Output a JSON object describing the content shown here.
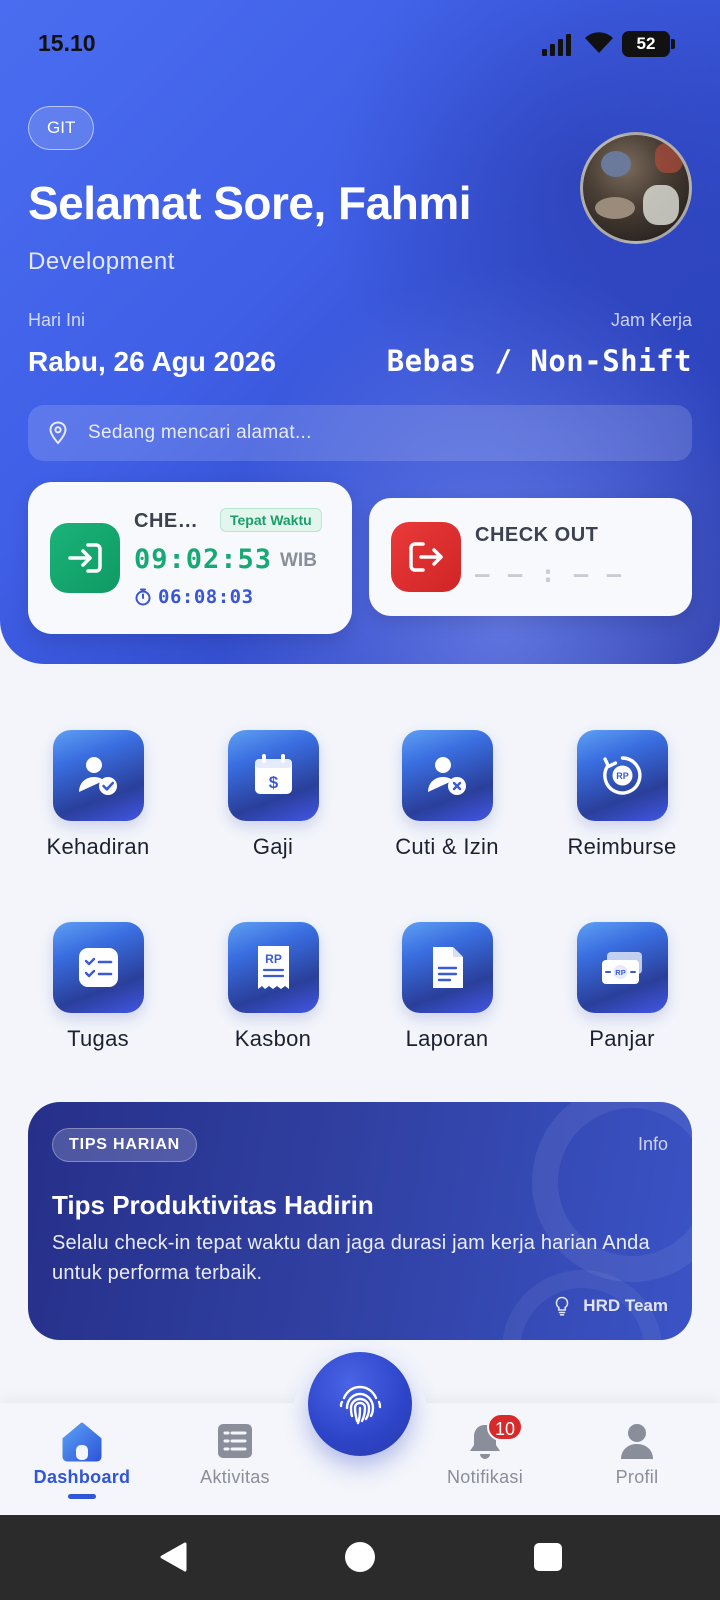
{
  "status_bar": {
    "time": "15.10",
    "battery": "52"
  },
  "header": {
    "company": "GIT",
    "greeting": "Selamat Sore, Fahmi",
    "department": "Development",
    "today_label": "Hari Ini",
    "today_value": "Rabu, 26 Agu 2026",
    "work_hours_label": "Jam Kerja",
    "work_hours_value": "Bebas / Non-Shift",
    "location_text": "Sedang mencari alamat..."
  },
  "check_in": {
    "title": "CHECK IN",
    "badge": "Tepat Waktu",
    "time": "09:02:53",
    "timezone": "WIB",
    "duration": "06:08:03"
  },
  "check_out": {
    "title": "CHECK OUT",
    "time": "— — : — —"
  },
  "menu": [
    {
      "label": "Kehadiran",
      "icon": "user-check-icon"
    },
    {
      "label": "Gaji",
      "icon": "salary-calendar-icon"
    },
    {
      "label": "Cuti & Izin",
      "icon": "user-leave-icon"
    },
    {
      "label": "Reimburse",
      "icon": "reimburse-icon"
    },
    {
      "label": "Tugas",
      "icon": "task-list-icon"
    },
    {
      "label": "Kasbon",
      "icon": "receipt-icon"
    },
    {
      "label": "Laporan",
      "icon": "document-icon"
    },
    {
      "label": "Panjar",
      "icon": "cash-icon"
    }
  ],
  "tips": {
    "badge": "TIPS HARIAN",
    "info": "Info",
    "title": "Tips Produktivitas Hadirin",
    "body": "Selalu check-in tepat waktu dan jaga durasi jam kerja harian Anda untuk performa terbaik.",
    "author": "HRD Team"
  },
  "bottom_nav": {
    "items": [
      {
        "label": "Dashboard",
        "icon": "home-icon",
        "active": true
      },
      {
        "label": "Aktivitas",
        "icon": "list-icon",
        "active": false
      },
      {
        "label": "Notifikasi",
        "icon": "bell-icon",
        "active": false,
        "badge": "10"
      },
      {
        "label": "Profil",
        "icon": "person-icon",
        "active": false
      }
    ],
    "fab_icon": "fingerprint-icon"
  },
  "colors": {
    "primary": "#3f5fe6",
    "check_in_green": "#17a874",
    "check_out_red": "#e03030",
    "accent_blue": "#2f56d9"
  }
}
